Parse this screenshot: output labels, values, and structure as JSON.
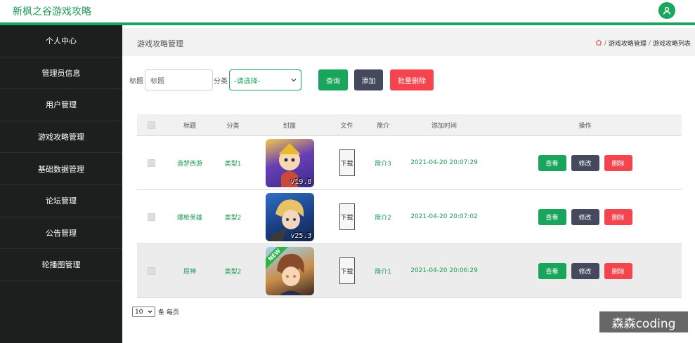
{
  "header": {
    "brand": "新枫之谷游戏攻略"
  },
  "sidebar": {
    "items": [
      {
        "label": "个人中心"
      },
      {
        "label": "管理员信息"
      },
      {
        "label": "用户管理"
      },
      {
        "label": "游戏攻略管理"
      },
      {
        "label": "基础数据管理"
      },
      {
        "label": "论坛管理"
      },
      {
        "label": "公告管理"
      },
      {
        "label": "轮播图管理"
      }
    ]
  },
  "page": {
    "title": "游戏攻略管理",
    "breadcrumb": [
      "游戏攻略管理",
      "游戏攻略列表"
    ]
  },
  "search": {
    "title_label": "标题",
    "title_placeholder": "标题",
    "category_label": "分类",
    "category_selected": "-请选择-",
    "query_label": "查询",
    "add_label": "添加",
    "batch_delete_label": "批量删除"
  },
  "table": {
    "headers": [
      "标题",
      "分类",
      "封面",
      "文件",
      "简介",
      "添加时间",
      "操作"
    ],
    "rows": [
      {
        "title": "造梦西游",
        "category": "类型1",
        "cover_version": "v19.8",
        "file": "下载",
        "intro": "简介3",
        "added": "2021-04-20 20:07:29"
      },
      {
        "title": "爆枪英雄",
        "category": "类型2",
        "cover_version": "v25.3",
        "file": "下载",
        "intro": "简介2",
        "added": "2021-04-20 20:07:02"
      },
      {
        "title": "原神",
        "category": "类型2",
        "cover_badge": "NEW",
        "file": "下载",
        "intro": "简介1",
        "added": "2021-04-20 20:06:29"
      }
    ],
    "actions": {
      "view": "查看",
      "edit": "修改",
      "delete": "删除"
    }
  },
  "pager": {
    "size": "10",
    "suffix": "条 每页"
  },
  "watermark": "森森coding",
  "colors": {
    "accent": "#19a55b",
    "dark_button": "#45495d",
    "danger": "#f4454f",
    "sidebar_bg": "#1d1f1e"
  }
}
